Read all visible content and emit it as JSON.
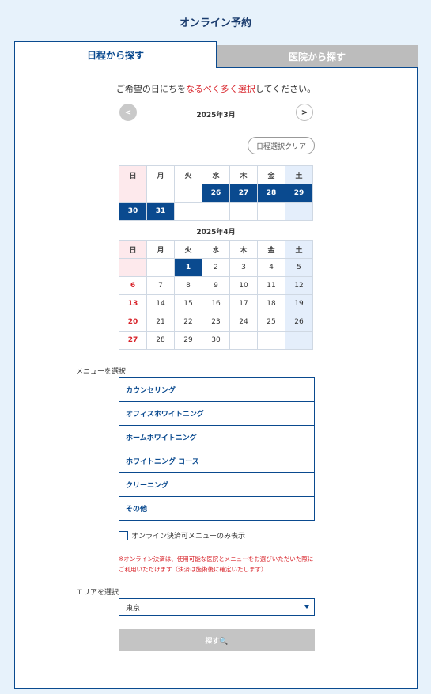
{
  "page_title": "オンライン予約",
  "tabs": [
    {
      "label": "日程から探す",
      "active": true
    },
    {
      "label": "医院から探す",
      "active": false
    }
  ],
  "instruction": {
    "prefix": "ご希望の日にちを",
    "highlight": "なるべく多く選択",
    "suffix": "してください。"
  },
  "nav": {
    "prev": "<",
    "next": ">"
  },
  "clear_label": "日程選択クリア",
  "weekdays": [
    "日",
    "月",
    "火",
    "水",
    "木",
    "金",
    "土"
  ],
  "months": [
    {
      "label": "2025年3月",
      "weeks": [
        [
          null,
          null,
          null,
          26,
          27,
          28,
          29
        ],
        [
          30,
          31,
          null,
          null,
          null,
          null,
          null
        ]
      ],
      "selected": [
        26,
        27,
        28,
        29,
        30,
        31
      ]
    },
    {
      "label": "2025年4月",
      "weeks": [
        [
          null,
          null,
          1,
          2,
          3,
          4,
          5
        ],
        [
          6,
          7,
          8,
          9,
          10,
          11,
          12
        ],
        [
          13,
          14,
          15,
          16,
          17,
          18,
          19
        ],
        [
          20,
          21,
          22,
          23,
          24,
          25,
          26
        ],
        [
          27,
          28,
          29,
          30,
          null,
          null,
          null
        ]
      ],
      "selected": [
        1
      ]
    }
  ],
  "menu": {
    "label": "メニューを選択",
    "items": [
      "カウンセリング",
      "オフィスホワイトニング",
      "ホームホワイトニング",
      "ホワイトニング コース",
      "クリーニング",
      "その他"
    ]
  },
  "online_only_label": "オンライン決済可メニューのみ表示",
  "note": "※オンライン決済は、使用可能な医院とメニューをお選びいただいた際にご利用いただけます（決済は施術後に確定いたします）",
  "area": {
    "label": "エリアを選択",
    "value": "東京"
  },
  "search_label": "探す🔍",
  "colors": {
    "primary": "#0a4a8f",
    "accent_red": "#d8232a",
    "background": "#e7f2fb"
  }
}
